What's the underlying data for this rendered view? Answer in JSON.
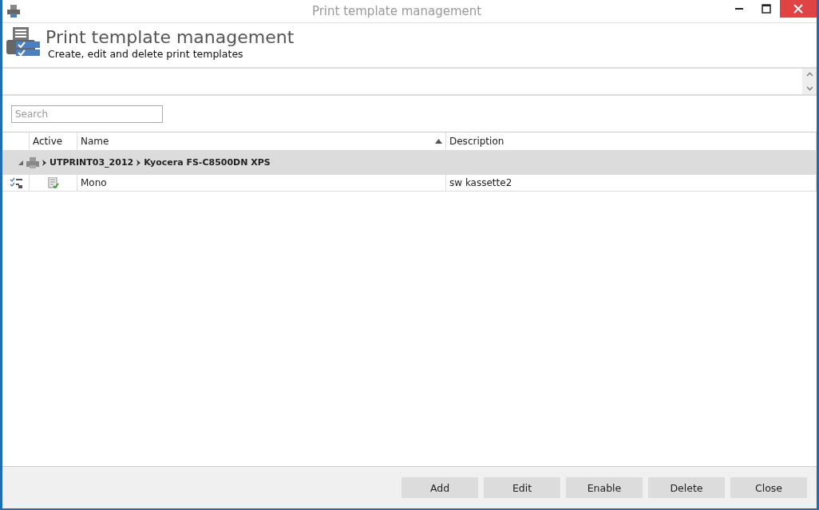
{
  "window": {
    "title": "Print template management"
  },
  "header": {
    "title": "Print template management",
    "subtitle": "Create, edit and delete print templates"
  },
  "search": {
    "placeholder": "Search"
  },
  "table": {
    "columns": [
      {
        "sorted": false
      },
      {
        "label": "Active",
        "sorted": false
      },
      {
        "label": "Name",
        "sorted": true
      },
      {
        "label": "Description",
        "sorted": false
      }
    ],
    "groups": [
      {
        "expanded": true,
        "path": [
          "UTPRINT03_2012",
          "Kyocera FS-C8500DN XPS"
        ],
        "rows": [
          {
            "active": true,
            "name": "Mono",
            "description": "sw kassette2"
          }
        ]
      }
    ]
  },
  "buttons": [
    "Add",
    "Edit",
    "Enable",
    "Delete",
    "Close"
  ]
}
